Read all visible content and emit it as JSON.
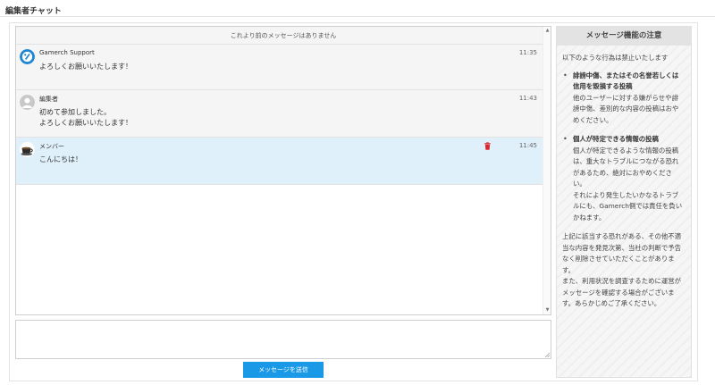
{
  "page": {
    "title": "編集者チャット"
  },
  "chat": {
    "no_more_label": "これより前のメッセージはありません",
    "messages": [
      {
        "sender": "Gamerch Support",
        "time": "11:35",
        "text": "よろしくお願いいたします！",
        "avatar_icon": "gamerch-logo-icon"
      },
      {
        "sender": "編集者",
        "time": "11:43",
        "text": "初めて参加しました。\nよろしくお願いいたします！",
        "avatar_icon": "default-user-icon"
      },
      {
        "sender": "メンバー",
        "time": "11:45",
        "text": "こんにちは！",
        "avatar_icon": "coffee-cup-icon",
        "deletable": true
      }
    ]
  },
  "composer": {
    "value": "",
    "send_label": "メッセージを送信"
  },
  "notice": {
    "title": "メッセージ機能の注意",
    "intro": "以下のような行為は禁止いたします",
    "rules": [
      {
        "title": "誹謗中傷、またはその名誉若しくは信用を毀損する投稿",
        "body": "他のユーザーに対する嫌がらせや誹謗中傷、差別的な内容の投稿はおやめください。"
      },
      {
        "title": "個人が特定できる情報の投稿",
        "body": "個人が特定できるような情報の投稿は、重大なトラブルにつながる恐れがあるため、絶対におやめください。\nそれにより発生したいかなるトラブルにも、Gamerch側では責任を負いかねます。"
      }
    ],
    "footer": "上記に該当する恐れがある、その他不適当な内容を発見次第、当社の判断で予告なく削除させていただくことがあります。\nまた、利用状況を調査するために運営がメッセージを確認する場合がございます。あらかじめご了承ください。"
  },
  "colors": {
    "accent": "#1a99e6",
    "highlight_row": "#dff0fb",
    "trash": "#d9262c"
  }
}
